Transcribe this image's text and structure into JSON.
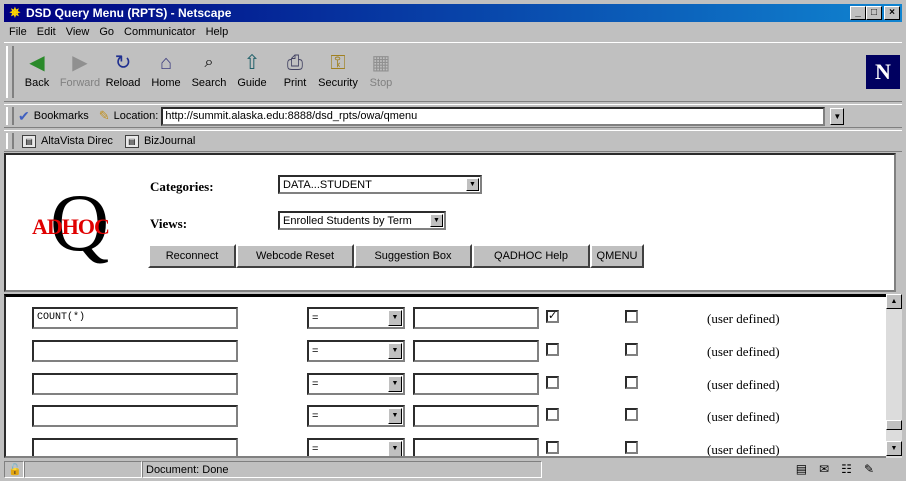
{
  "window": {
    "title": "DSD Query Menu (RPTS) - Netscape"
  },
  "menu": [
    "File",
    "Edit",
    "View",
    "Go",
    "Communicator",
    "Help"
  ],
  "toolbar": [
    {
      "label": "Back",
      "icon": "◀",
      "enabled": true
    },
    {
      "label": "Forward",
      "icon": "▶",
      "enabled": false
    },
    {
      "label": "Reload",
      "icon": "↻",
      "enabled": true
    },
    {
      "label": "Home",
      "icon": "⌂",
      "enabled": true
    },
    {
      "label": "Search",
      "icon": "🔍",
      "enabled": true
    },
    {
      "label": "Guide",
      "icon": "⇧",
      "enabled": true
    },
    {
      "label": "Print",
      "icon": "⎙",
      "enabled": true
    },
    {
      "label": "Security",
      "icon": "🔒",
      "enabled": true
    },
    {
      "label": "Stop",
      "icon": "■",
      "enabled": false
    }
  ],
  "location": {
    "bookmarks_label": "Bookmarks",
    "location_label": "Location:",
    "url": "http://summit.alaska.edu:8888/dsd_rpts/owa/qmenu"
  },
  "personal_links": [
    "AltaVista Direc",
    "BizJournal"
  ],
  "form": {
    "logo_letter": "Q",
    "logo_text": "ADHOC",
    "categories_label": "Categories:",
    "categories_value": "DATA...STUDENT",
    "views_label": "Views:",
    "views_value": "Enrolled Students by Term",
    "buttons": [
      "Reconnect",
      "Webcode Reset",
      "Suggestion Box",
      "QADHOC Help",
      "QMENU"
    ]
  },
  "rows": [
    {
      "column": "COUNT(*)",
      "operator": "=",
      "value": "",
      "check1": true,
      "check2": false,
      "note": "(user defined)"
    },
    {
      "column": "",
      "operator": "=",
      "value": "",
      "check1": false,
      "check2": false,
      "note": "(user defined)"
    },
    {
      "column": "",
      "operator": "=",
      "value": "",
      "check1": false,
      "check2": false,
      "note": "(user defined)"
    },
    {
      "column": "",
      "operator": "=",
      "value": "",
      "check1": false,
      "check2": false,
      "note": "(user defined)"
    },
    {
      "column": "",
      "operator": "=",
      "value": "",
      "check1": false,
      "check2": false,
      "note": "(user defined)"
    }
  ],
  "status": {
    "text": "Document: Done"
  },
  "icons": {
    "back": "back-icon",
    "forward": "forward-icon",
    "reload": "reload-icon",
    "home": "home-icon",
    "search": "search-icon",
    "guide": "guide-icon",
    "print": "print-icon",
    "security": "security-icon",
    "stop": "stop-icon"
  }
}
